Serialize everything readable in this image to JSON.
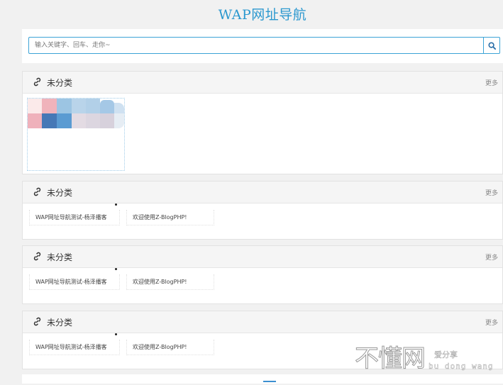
{
  "site": {
    "title": "WAP网址导航"
  },
  "search": {
    "placeholder": "输入关键字、回车、走你~",
    "value": "",
    "button_icon": "search-icon"
  },
  "sections": [
    {
      "title": "未分类",
      "more": "更多",
      "icon": "link-icon",
      "links": []
    },
    {
      "title": "未分类",
      "more": "更多",
      "icon": "link-icon",
      "links": [
        "WAP网址导航测试-杨泽播客",
        "欢迎使用Z-BlogPHP!"
      ]
    },
    {
      "title": "未分类",
      "more": "更多",
      "icon": "link-icon",
      "links": [
        "WAP网址导航测试-杨泽播客",
        "欢迎使用Z-BlogPHP!"
      ]
    },
    {
      "title": "未分类",
      "more": "更多",
      "icon": "link-icon",
      "links": [
        "WAP网址导航测试-杨泽播客",
        "欢迎使用Z-BlogPHP!"
      ]
    }
  ],
  "watermark": {
    "main": "不懂网",
    "top": "爱分享",
    "bottom": "bu dong wang"
  },
  "colors": {
    "accent": "#2b98cf",
    "border": "#3ca3d6",
    "background": "#f1f1f1",
    "panel_head": "#f5f5f5"
  }
}
